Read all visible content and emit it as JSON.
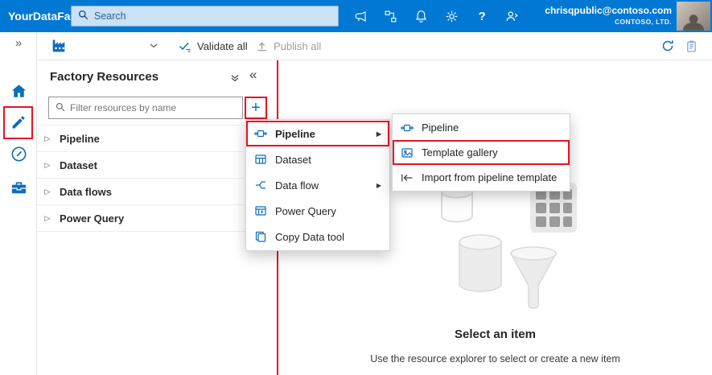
{
  "topbar": {
    "app_title": "YourDataFactory",
    "search_placeholder": "Search",
    "help_glyph": "?",
    "user_email": "chrisqpublic@contoso.com",
    "user_org": "CONTOSO, LTD."
  },
  "toolbar": {
    "validate_label": "Validate all",
    "publish_label": "Publish all"
  },
  "rail": {
    "expand_glyph": "»"
  },
  "resources_panel": {
    "title": "Factory Resources",
    "collapse_glyph": "«",
    "filter_placeholder": "Filter resources by name",
    "plus_glyph": "+",
    "chevron_glyph": "▷",
    "items": [
      {
        "label": "Pipeline"
      },
      {
        "label": "Dataset"
      },
      {
        "label": "Data flows"
      },
      {
        "label": "Power Query"
      }
    ]
  },
  "context_menu": {
    "arrow_glyph": "▶",
    "items": [
      {
        "label": "Pipeline",
        "icon": "pipeline-icon",
        "has_submenu": true,
        "highlighted": true
      },
      {
        "label": "Dataset",
        "icon": "dataset-icon",
        "has_submenu": false,
        "highlighted": false
      },
      {
        "label": "Data flow",
        "icon": "data-flow-icon",
        "has_submenu": true,
        "highlighted": false
      },
      {
        "label": "Power Query",
        "icon": "power-query-icon",
        "has_submenu": false,
        "highlighted": false
      },
      {
        "label": "Copy Data tool",
        "icon": "copy-data-icon",
        "has_submenu": false,
        "highlighted": false
      }
    ]
  },
  "submenu": {
    "items": [
      {
        "label": "Pipeline",
        "icon": "pipeline-icon",
        "highlighted": false
      },
      {
        "label": "Template gallery",
        "icon": "template-gallery-icon",
        "highlighted": true
      },
      {
        "label": "Import from pipeline template",
        "icon": "import-icon",
        "highlighted": false
      }
    ]
  },
  "canvas": {
    "title": "Select an item",
    "subtitle": "Use the resource explorer to select or create a new item"
  },
  "colors": {
    "topbar_blue": "#0078d4",
    "accent_blue": "#0f6cbd",
    "highlight_red": "#e81123",
    "disabled_gray": "#a19f9d"
  }
}
